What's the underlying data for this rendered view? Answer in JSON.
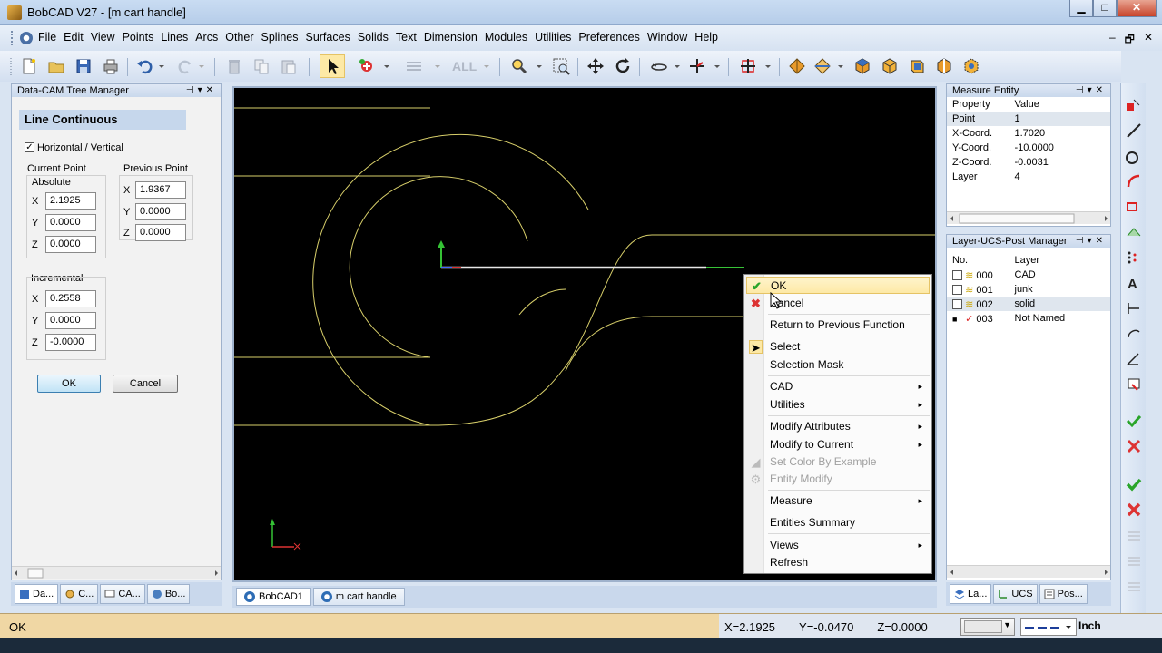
{
  "window": {
    "title": "BobCAD V27 - [m cart handle]",
    "min": "▁",
    "max": "□",
    "close": "✕"
  },
  "menu": {
    "items": [
      "File",
      "Edit",
      "View",
      "Points",
      "Lines",
      "Arcs",
      "Other",
      "Splines",
      "Surfaces",
      "Solids",
      "Text",
      "Dimension",
      "Modules",
      "Utilities",
      "Preferences",
      "Window",
      "Help"
    ],
    "mdi_min": "–",
    "mdi_restore": "🗗",
    "mdi_close": "✕"
  },
  "toolbar": {
    "all_label": "ALL"
  },
  "tree_manager": {
    "header": "Data-CAM Tree Manager",
    "function_title": "Line Continuous",
    "horizontal_vertical_label": "Horizontal / Vertical",
    "horizontal_vertical_checked": "✓",
    "current_point_label": "Current Point",
    "absolute_label": "Absolute",
    "previous_point_label": "Previous Point",
    "incremental_label": "Incremental",
    "x_label": "X",
    "y_label": "Y",
    "z_label": "Z",
    "absolute": {
      "x": "2.1925",
      "y": "0.0000",
      "z": "0.0000"
    },
    "previous": {
      "x": "1.9367",
      "y": "0.0000",
      "z": "0.0000"
    },
    "incremental": {
      "x": "0.2558",
      "y": "0.0000",
      "z": "-0.0000"
    },
    "ok_label": "OK",
    "cancel_label": "Cancel",
    "tabs": [
      "Da...",
      "C...",
      "CA...",
      "Bo..."
    ]
  },
  "document_tabs": [
    "BobCAD1",
    "m cart handle"
  ],
  "context_menu": {
    "items": [
      {
        "label": "OK",
        "icon": "check-icon"
      },
      {
        "label": "Cancel",
        "icon": "x-icon"
      },
      {
        "label": "Return to Previous Function"
      },
      {
        "label": "Select",
        "icon": "pointer-icon"
      },
      {
        "label": "Selection Mask"
      },
      {
        "label": "CAD",
        "submenu": "▸"
      },
      {
        "label": "Utilities",
        "submenu": "▸"
      },
      {
        "label": "Modify Attributes",
        "submenu": "▸"
      },
      {
        "label": "Modify to Current",
        "submenu": "▸"
      },
      {
        "label": "Set Color By Example",
        "disabled": true
      },
      {
        "label": "Entity Modify",
        "disabled": true
      },
      {
        "label": "Measure",
        "submenu": "▸"
      },
      {
        "label": "Entities Summary"
      },
      {
        "label": "Views",
        "submenu": "▸"
      },
      {
        "label": "Refresh"
      }
    ]
  },
  "measure_entity": {
    "header": "Measure Entity",
    "col_property": "Property",
    "col_value": "Value",
    "rows": [
      {
        "property": "Point",
        "value": "1"
      },
      {
        "property": "X-Coord.",
        "value": "1.7020"
      },
      {
        "property": "Y-Coord.",
        "value": "-10.0000"
      },
      {
        "property": "Z-Coord.",
        "value": "-0.0031"
      },
      {
        "property": "Layer",
        "value": "4"
      }
    ]
  },
  "layer_manager": {
    "header": "Layer-UCS-Post Manager",
    "col_no": "No.",
    "col_layer": "Layer",
    "rows": [
      {
        "no": "000",
        "name": "CAD"
      },
      {
        "no": "001",
        "name": "junk"
      },
      {
        "no": "002",
        "name": "solid"
      },
      {
        "no": "003",
        "name": "Not Named"
      }
    ],
    "tabs": [
      "La...",
      "UCS",
      "Pos..."
    ]
  },
  "status": {
    "message": "OK",
    "x": "X=2.1925",
    "y": "Y=-0.0470",
    "z": "Z=0.0000",
    "unit": "Inch"
  },
  "colors": {
    "canvas_bg": "#000000",
    "geometry": "#d8cf6a",
    "status_bg": "#f0d7a4",
    "highlight": "#fde9a6"
  }
}
